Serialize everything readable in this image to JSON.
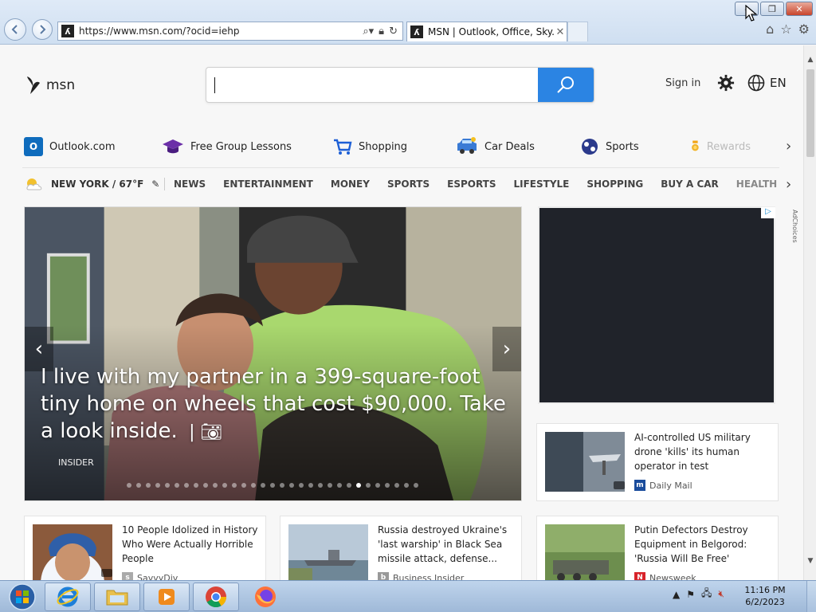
{
  "browser": {
    "url": "https://www.msn.com/?ocid=iehp",
    "tab_title": "MSN | Outlook, Office, Sky...",
    "buttons": {
      "back": "back-icon",
      "forward": "forward-icon",
      "minimize": "–",
      "restore": "❐",
      "close": "✕"
    }
  },
  "header": {
    "logo_text": "msn",
    "search_placeholder": "",
    "sign_in": "Sign in",
    "language": "EN"
  },
  "quick_links": [
    {
      "label": "Outlook.com",
      "icon": "outlook-icon",
      "color": "#0f6cbd"
    },
    {
      "label": "Free Group Lessons",
      "icon": "graduation-cap-icon",
      "color": "#6b2fa8"
    },
    {
      "label": "Shopping",
      "icon": "shopping-cart-icon",
      "color": "#1d5fd6"
    },
    {
      "label": "Car Deals",
      "icon": "car-icon",
      "color": "#3a7bd5"
    },
    {
      "label": "Sports",
      "icon": "sports-ball-icon",
      "color": "#2b3a8c"
    },
    {
      "label": "Rewards",
      "icon": "rewards-medal-icon",
      "color": "#f2a516"
    }
  ],
  "nav": {
    "weather": "NEW YORK / 67°F",
    "links": [
      "NEWS",
      "ENTERTAINMENT",
      "MONEY",
      "SPORTS",
      "ESPORTS",
      "LIFESTYLE",
      "SHOPPING",
      "BUY A CAR",
      "HEALTH"
    ]
  },
  "hero": {
    "title": "I live with my partner in a 399-square-foot tiny home on wheels that cost $90,000. Take a look inside.",
    "source": "Insider",
    "slide_count": 31,
    "active_slide": 24
  },
  "ad": {
    "adchoices_label": "AdChoices"
  },
  "cards": [
    {
      "title": "AI-controlled US military drone 'kills' its human operator in test",
      "source": "Daily Mail",
      "source_logo": "m"
    },
    {
      "title": "10 People Idolized in History Who Were Actually Horrible People",
      "source": "SavvyDiv",
      "source_logo": "s"
    },
    {
      "title": "Russia destroyed Ukraine's 'last warship' in Black Sea missile attack, defense...",
      "source": "Business Insider",
      "source_logo": "b"
    },
    {
      "title": "Putin Defectors Destroy Equipment in Belgorod: 'Russia Will Be Free'",
      "source": "Newsweek",
      "source_logo": "N"
    }
  ],
  "taskbar": {
    "time": "11:16 PM",
    "date": "6/2/2023"
  }
}
